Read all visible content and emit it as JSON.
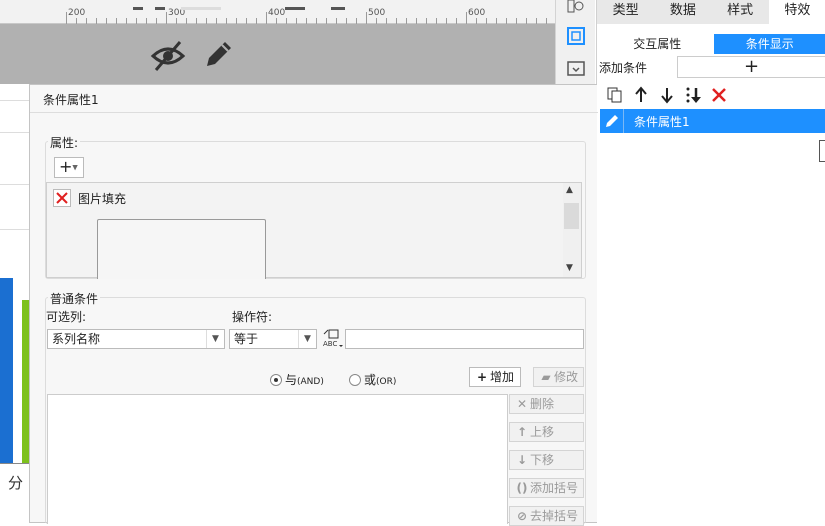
{
  "ruler": {
    "labels": [
      "200",
      "300",
      "400",
      "500",
      "600"
    ]
  },
  "canvas": {
    "partial_text": "分"
  },
  "tool_strip": {
    "icons": [
      "info-icon",
      "frame-icon",
      "panel-icon"
    ]
  },
  "panel": {
    "tabs": [
      "类型",
      "数据",
      "样式",
      "特效"
    ],
    "active_tab": "特效",
    "subtabs": [
      "交互属性",
      "条件显示"
    ],
    "active_subtab": "条件显示",
    "add_condition_label": "添加条件",
    "add_symbol": "+",
    "toolbar_icons": [
      "copy-icon",
      "move-up-icon",
      "move-down-icon",
      "reorder-icon",
      "delete-icon"
    ],
    "condition_item": "条件属性1"
  },
  "dialog": {
    "title": "条件属性1",
    "property_group_label": "属性:",
    "plus_symbol": "+",
    "property_item": "图片填充",
    "normal_group_label": "普通条件",
    "column_label": "可选列:",
    "column_value": "系列名称",
    "operator_label": "操作符:",
    "operator_value": "等于",
    "value_input": "",
    "radio_and": {
      "label": "与",
      "sub": "(AND)",
      "checked": true
    },
    "radio_or": {
      "label": "或",
      "sub": "(OR)",
      "checked": false
    },
    "buttons": {
      "add": "增加",
      "edit": "修改",
      "delete": "删除",
      "up": "上移",
      "down": "下移",
      "add_paren": "添加括号",
      "remove_paren": "去掉括号"
    }
  },
  "colors": {
    "accent": "#1e90ff",
    "bar_blue": "#1b6fd1",
    "bar_green": "#7dc11c",
    "delete_red": "#e02020"
  }
}
